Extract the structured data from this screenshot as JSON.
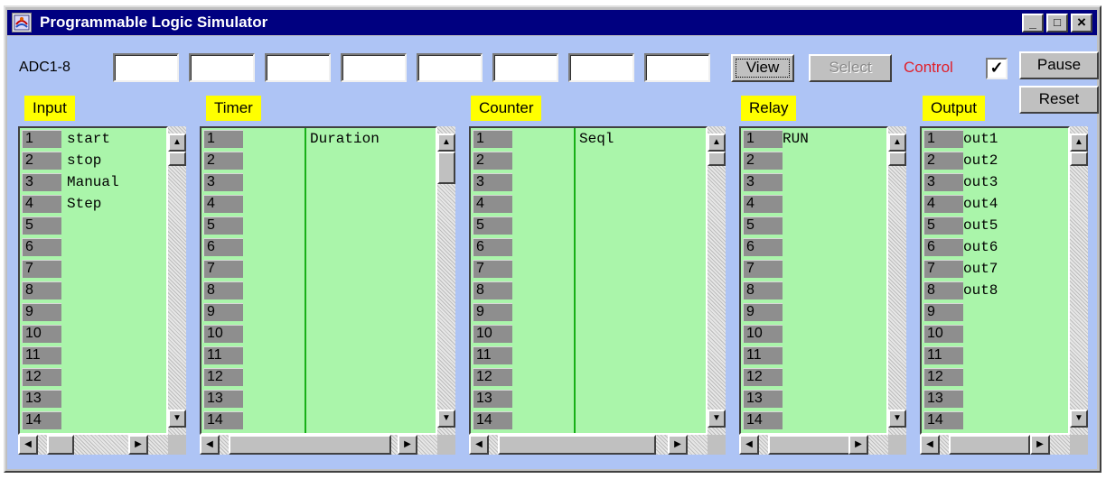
{
  "window": {
    "title": "Programmable Logic Simulator",
    "icon": "sun-applet-icon",
    "controls": {
      "minimize": "_",
      "maximize": "□",
      "close": "×"
    }
  },
  "toolbar": {
    "adc_label": "ADC1-8",
    "adc_values": [
      "",
      "",
      "",
      "",
      "",
      "",
      "",
      ""
    ],
    "view_label": "View",
    "select_label": "Select",
    "control_label": "Control",
    "control_checked": true,
    "pause_label": "Pause",
    "reset_label": "Reset"
  },
  "panels": {
    "input": {
      "title": "Input",
      "rows": [
        {
          "num": "1",
          "name": "start"
        },
        {
          "num": "2",
          "name": "stop"
        },
        {
          "num": "3",
          "name": "Manual"
        },
        {
          "num": "4",
          "name": "Step"
        },
        {
          "num": "5",
          "name": ""
        },
        {
          "num": "6",
          "name": ""
        },
        {
          "num": "7",
          "name": ""
        },
        {
          "num": "8",
          "name": ""
        },
        {
          "num": "9",
          "name": ""
        },
        {
          "num": "10",
          "name": ""
        },
        {
          "num": "11",
          "name": ""
        },
        {
          "num": "12",
          "name": ""
        },
        {
          "num": "13",
          "name": ""
        },
        {
          "num": "14",
          "name": ""
        }
      ]
    },
    "timer": {
      "title": "Timer",
      "rows": [
        {
          "num": "1",
          "value": "",
          "name": "Duration"
        },
        {
          "num": "2",
          "value": "",
          "name": ""
        },
        {
          "num": "3",
          "value": "",
          "name": ""
        },
        {
          "num": "4",
          "value": "",
          "name": ""
        },
        {
          "num": "5",
          "value": "",
          "name": ""
        },
        {
          "num": "6",
          "value": "",
          "name": ""
        },
        {
          "num": "7",
          "value": "",
          "name": ""
        },
        {
          "num": "8",
          "value": "",
          "name": ""
        },
        {
          "num": "9",
          "value": "",
          "name": ""
        },
        {
          "num": "10",
          "value": "",
          "name": ""
        },
        {
          "num": "11",
          "value": "",
          "name": ""
        },
        {
          "num": "12",
          "value": "",
          "name": ""
        },
        {
          "num": "13",
          "value": "",
          "name": ""
        },
        {
          "num": "14",
          "value": "",
          "name": ""
        }
      ]
    },
    "counter": {
      "title": "Counter",
      "rows": [
        {
          "num": "1",
          "value": "",
          "name": "Seql"
        },
        {
          "num": "2",
          "value": "",
          "name": ""
        },
        {
          "num": "3",
          "value": "",
          "name": ""
        },
        {
          "num": "4",
          "value": "",
          "name": ""
        },
        {
          "num": "5",
          "value": "",
          "name": ""
        },
        {
          "num": "6",
          "value": "",
          "name": ""
        },
        {
          "num": "7",
          "value": "",
          "name": ""
        },
        {
          "num": "8",
          "value": "",
          "name": ""
        },
        {
          "num": "9",
          "value": "",
          "name": ""
        },
        {
          "num": "10",
          "value": "",
          "name": ""
        },
        {
          "num": "11",
          "value": "",
          "name": ""
        },
        {
          "num": "12",
          "value": "",
          "name": ""
        },
        {
          "num": "13",
          "value": "",
          "name": ""
        },
        {
          "num": "14",
          "value": "",
          "name": ""
        }
      ]
    },
    "relay": {
      "title": "Relay",
      "rows": [
        {
          "num": "1",
          "name": "RUN"
        },
        {
          "num": "2",
          "name": ""
        },
        {
          "num": "3",
          "name": ""
        },
        {
          "num": "4",
          "name": ""
        },
        {
          "num": "5",
          "name": ""
        },
        {
          "num": "6",
          "name": ""
        },
        {
          "num": "7",
          "name": ""
        },
        {
          "num": "8",
          "name": ""
        },
        {
          "num": "9",
          "name": ""
        },
        {
          "num": "10",
          "name": ""
        },
        {
          "num": "11",
          "name": ""
        },
        {
          "num": "12",
          "name": ""
        },
        {
          "num": "13",
          "name": ""
        },
        {
          "num": "14",
          "name": ""
        }
      ]
    },
    "output": {
      "title": "Output",
      "rows": [
        {
          "num": "1",
          "name": "out1"
        },
        {
          "num": "2",
          "name": "out2"
        },
        {
          "num": "3",
          "name": "out3"
        },
        {
          "num": "4",
          "name": "out4"
        },
        {
          "num": "5",
          "name": "out5"
        },
        {
          "num": "6",
          "name": "out6"
        },
        {
          "num": "7",
          "name": "out7"
        },
        {
          "num": "8",
          "name": "out8"
        },
        {
          "num": "9",
          "name": ""
        },
        {
          "num": "10",
          "name": ""
        },
        {
          "num": "11",
          "name": ""
        },
        {
          "num": "12",
          "name": ""
        },
        {
          "num": "13",
          "name": ""
        },
        {
          "num": "14",
          "name": ""
        }
      ]
    }
  },
  "scroll_glyphs": {
    "up": "▲",
    "down": "▼",
    "left": "◀",
    "right": "▶"
  },
  "colors": {
    "titlebar": "#000080",
    "client_bg": "#aec4f5",
    "list_bg": "#aaf5aa",
    "panel_label_bg": "#ffff00",
    "control_label": "#e0202a",
    "column_divider": "#17b017"
  }
}
